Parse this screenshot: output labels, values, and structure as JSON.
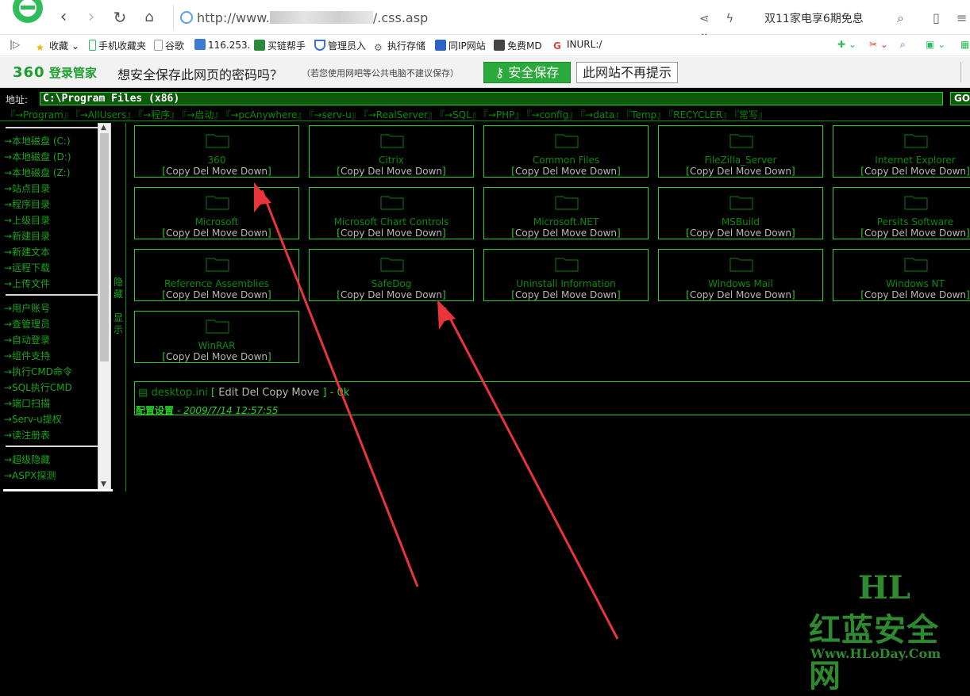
{
  "browser": {
    "url_prefix": "http://www.",
    "url_suffix": "/.css.asp",
    "search_hint": "双11家电享6期免息",
    "bookmarks": [
      "收藏",
      "手机收藏夹",
      "谷歌",
      "116.253.",
      "买链帮手",
      "管理员入",
      "执行存储",
      "同IP网站",
      "免费MD",
      "INURL:/"
    ]
  },
  "savebar": {
    "brand_num": "360",
    "brand_text": "登录管家",
    "question": "想安全保存此网页的密码吗？",
    "note": "（若您使用网吧等公共电脑不建议保存）",
    "save_label": "安全保存",
    "never_label": "此网站不再提示"
  },
  "shell": {
    "address_label": "地址:",
    "address_value": "C:\\Program Files (x86)",
    "go_label": "GO",
    "quick_links": [
      "『→Program』",
      "『→AllUsers』",
      "『→程序』",
      "『→启动』",
      "『→pcAnywhere』",
      "『→serv-u』",
      "『→RealServer』",
      "『→SQL』",
      "『→PHP』",
      "『→config』",
      "『→data』",
      "『Temp』",
      "『RECYCLER』",
      "『常写』"
    ],
    "sidebar_group1": [
      "→本地磁盘 (C:)",
      "→本地磁盘 (D:)",
      "→本地磁盘 (Z:)",
      "→站点目录",
      "→程序目录",
      "→上级目录",
      "→新建目录",
      "→新建文本",
      "→远程下载",
      "→上传文件"
    ],
    "sidebar_group2": [
      "→用户账号",
      "→查管理员",
      "→自动登录",
      "→组件支持",
      "→执行CMD命令",
      "→SQL执行CMD",
      "→端口扫描",
      "→Serv-u提权",
      "→读注册表"
    ],
    "sidebar_group3": [
      "→超级隐藏",
      "→ASPX探测"
    ],
    "toggle_hide": "隐藏",
    "toggle_show": "显示",
    "folders": [
      "360",
      "Citrix",
      "Common Files",
      "FileZilla_Server",
      "Internet Explorer",
      "Microsoft",
      "Microsoft Chart Controls",
      "Microsoft.NET",
      "MSBuild",
      "Persits Software",
      "Reference Assemblies",
      "SafeDog",
      "Uninstall Information",
      "Windows Mail",
      "Windows NT",
      "WinRAR"
    ],
    "folder_ops": "Copy Del Move Down",
    "file": {
      "name": "desktop.ini",
      "ops": "Edit Del Copy Move",
      "size": "- 0k",
      "meta_label": "配置设置",
      "date": "- 2009/7/14 12:57:55"
    }
  },
  "watermark": {
    "big": "HL",
    "title": "红蓝安全网",
    "site": "Www.HLoDay.Com"
  }
}
